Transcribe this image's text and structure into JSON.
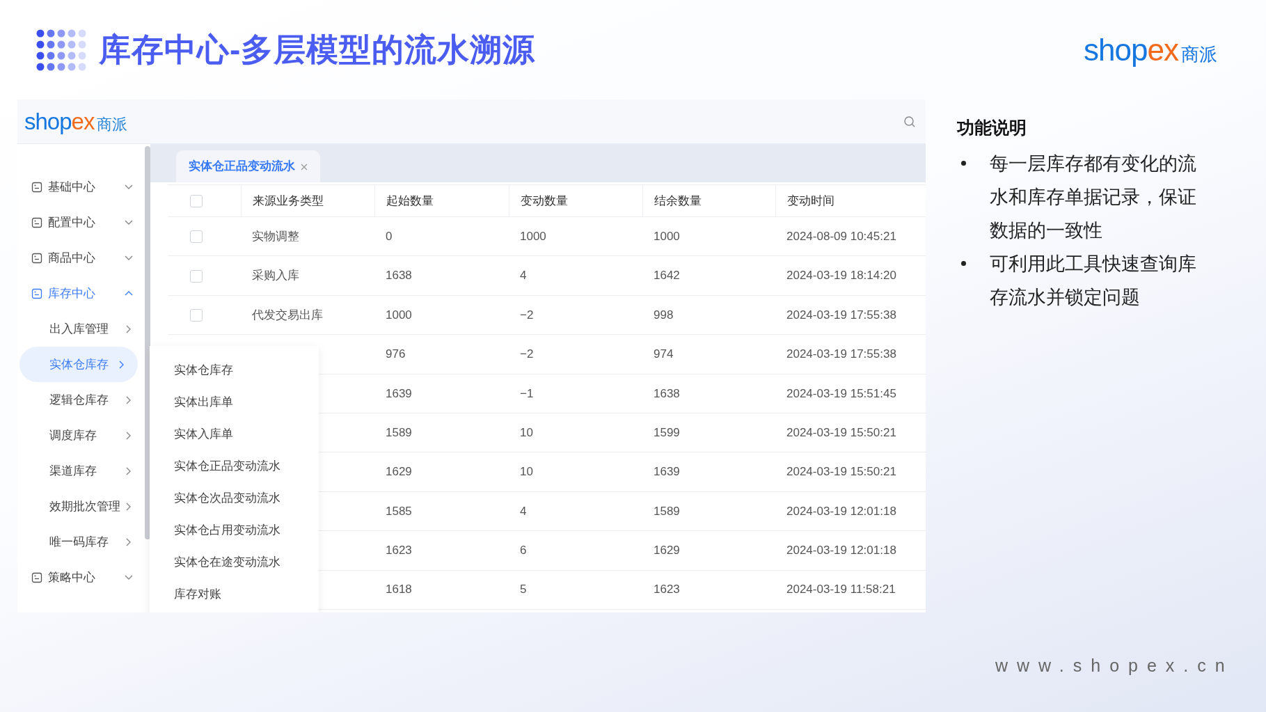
{
  "slide_title": "库存中心-多层模型的流水溯源",
  "brand_logo": {
    "wordmark": [
      {
        "text": "shop",
        "accent": false
      },
      {
        "text": "ex",
        "accent": true
      }
    ],
    "cn": "商派"
  },
  "app": {
    "logo": {
      "wordmark": [
        {
          "text": "shop",
          "accent": false
        },
        {
          "text": "ex",
          "accent": true
        }
      ],
      "cn": "商派"
    },
    "sidebar": [
      {
        "label": "基础中心",
        "kind": "group",
        "expanded": false,
        "selected": false
      },
      {
        "label": "配置中心",
        "kind": "group",
        "expanded": false,
        "selected": false
      },
      {
        "label": "商品中心",
        "kind": "group",
        "expanded": false,
        "selected": false
      },
      {
        "label": "库存中心",
        "kind": "group",
        "expanded": true,
        "selected": true,
        "children": [
          {
            "label": "出入库管理",
            "kind": "sub",
            "selected": false
          },
          {
            "label": "实体仓库存",
            "kind": "sub",
            "selected": true
          },
          {
            "label": "逻辑仓库存",
            "kind": "sub",
            "selected": false
          },
          {
            "label": "调度库存",
            "kind": "sub",
            "selected": false
          },
          {
            "label": "渠道库存",
            "kind": "sub",
            "selected": false
          },
          {
            "label": "效期批次管理",
            "kind": "sub",
            "selected": false
          },
          {
            "label": "唯一码库存",
            "kind": "sub",
            "selected": false
          }
        ]
      },
      {
        "label": "策略中心",
        "kind": "group",
        "expanded": false,
        "selected": false
      }
    ],
    "tabs": [
      {
        "label": "实体仓正品变动流水",
        "selected": true
      }
    ],
    "table": {
      "columns": [
        "来源业务类型",
        "起始数量",
        "变动数量",
        "结余数量",
        "变动时间"
      ],
      "header_checked": false,
      "rows": [
        {
          "checked": false,
          "type": "实物调整",
          "start": "0",
          "change": "1000",
          "balance": "1000",
          "time": "2024-08-09 10:45:21"
        },
        {
          "checked": false,
          "type": "采购入库",
          "start": "1638",
          "change": "4",
          "balance": "1642",
          "time": "2024-03-19 18:14:20"
        },
        {
          "checked": false,
          "type": "代发交易出库",
          "start": "1000",
          "change": "−2",
          "balance": "998",
          "time": "2024-03-19 17:55:38"
        },
        {
          "start": "976",
          "change": "−2",
          "balance": "974",
          "time": "2024-03-19 17:55:38"
        },
        {
          "start": "1639",
          "change": "−1",
          "balance": "1638",
          "time": "2024-03-19 15:51:45"
        },
        {
          "start": "1589",
          "change": "10",
          "balance": "1599",
          "time": "2024-03-19 15:50:21"
        },
        {
          "start": "1629",
          "change": "10",
          "balance": "1639",
          "time": "2024-03-19 15:50:21"
        },
        {
          "start": "1585",
          "change": "4",
          "balance": "1589",
          "time": "2024-03-19 12:01:18"
        },
        {
          "start": "1623",
          "change": "6",
          "balance": "1629",
          "time": "2024-03-19 12:01:18"
        },
        {
          "start": "1618",
          "change": "5",
          "balance": "1623",
          "time": "2024-03-19 11:58:21"
        }
      ]
    },
    "flyout_menu": [
      "实体仓库存",
      "实体出库单",
      "实体入库单",
      "实体仓正品变动流水",
      "实体仓次品变动流水",
      "实体仓占用变动流水",
      "实体仓在途变动流水",
      "库存对账"
    ]
  },
  "notes": {
    "heading": "功能说明",
    "bullets": [
      "每一层库存都有变化的流水和库存单据记录，保证数据的一致性",
      "可利用此工具快速查询库存流水并锁定问题"
    ]
  },
  "footer_url": "www.shopex.cn"
}
